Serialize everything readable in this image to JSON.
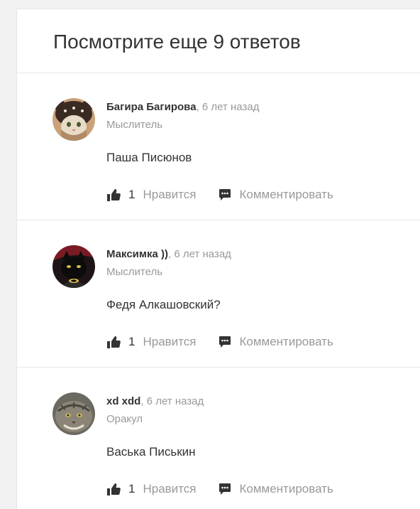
{
  "header": {
    "title": "Посмотрите еще 9 ответов"
  },
  "answers": [
    {
      "author": "Багира Багирова",
      "time": ", 6 лет назад",
      "rank": "Мыслитель",
      "text": "Паша Писюнов",
      "likes": "1",
      "like_label": "Нравится",
      "comment_label": "Комментировать"
    },
    {
      "author": "Максимка ))",
      "time": ", 6 лет назад",
      "rank": "Мыслитель",
      "text": "Федя Алкашовский?",
      "likes": "1",
      "like_label": "Нравится",
      "comment_label": "Комментировать"
    },
    {
      "author": "xd xdd",
      "time": ", 6 лет назад",
      "rank": "Оракул",
      "text": "Васька Писькин",
      "likes": "1",
      "like_label": "Нравится",
      "comment_label": "Комментировать"
    }
  ],
  "colors": {
    "text": "#333333",
    "muted": "#999999",
    "divider": "#e6e6e6",
    "background": "#f2f2f2"
  },
  "icons": {
    "like": "thumbs-up-icon",
    "comment": "comment-bubble-icon"
  }
}
